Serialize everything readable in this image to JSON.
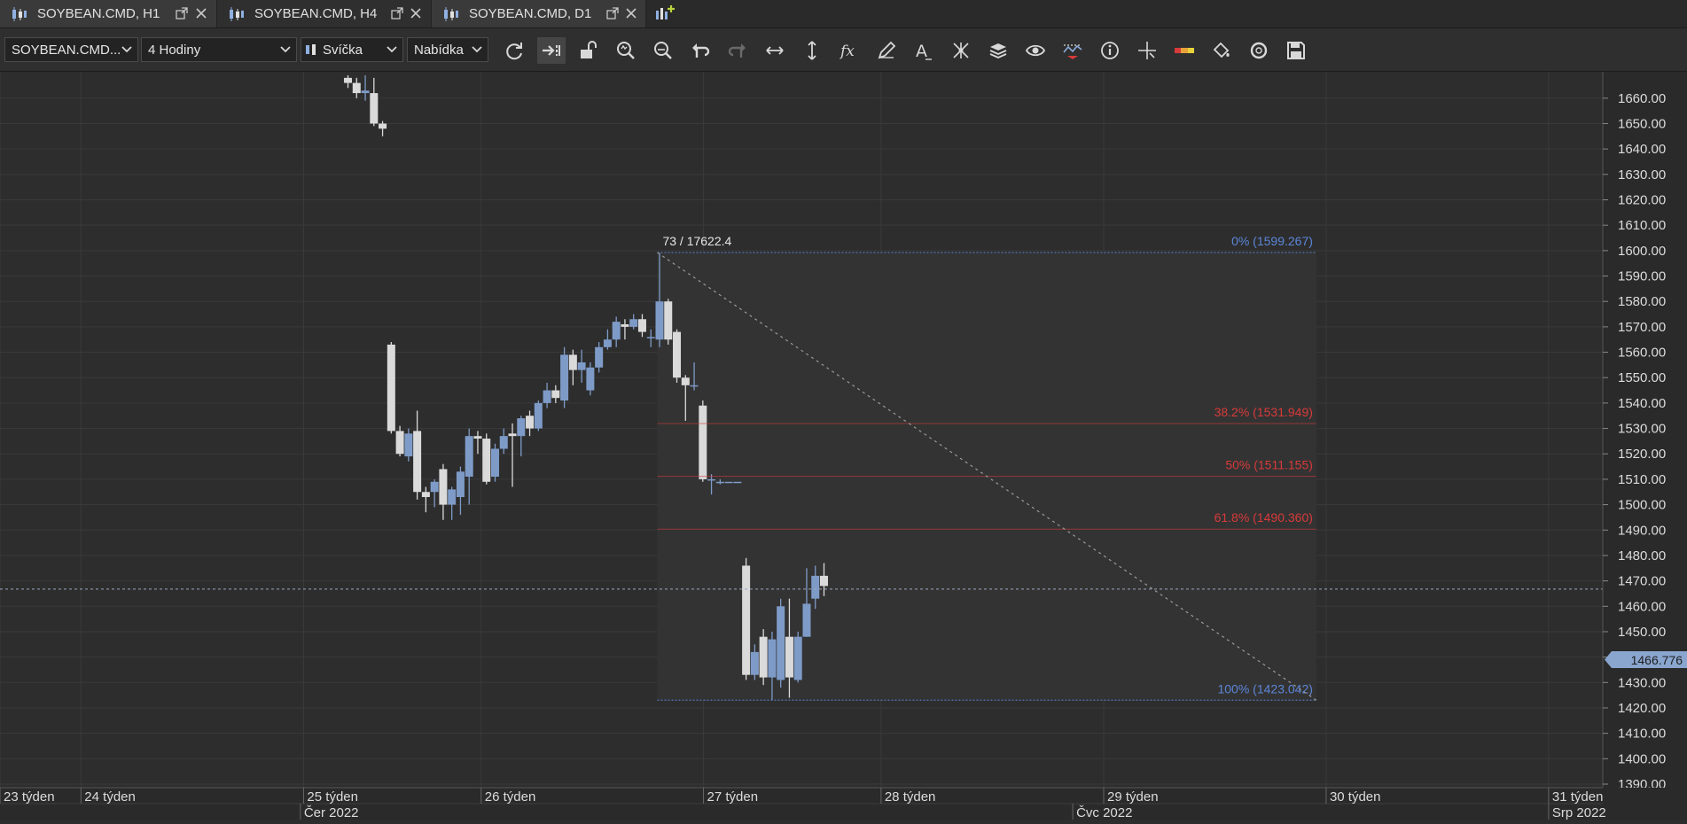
{
  "tabs": [
    {
      "label": "SOYBEAN.CMD, H1",
      "active": false
    },
    {
      "label": "SOYBEAN.CMD, H4",
      "active": true
    },
    {
      "label": "SOYBEAN.CMD, D1",
      "active": false
    }
  ],
  "toolbar": {
    "symbol": "SOYBEAN.CMD...",
    "timeframe": "4 Hodiny",
    "chart_type": "Svíčka",
    "price_type": "Nabídka",
    "tools": [
      "refresh-icon",
      "auto-scroll-icon",
      "unlock-icon",
      "zoom-in-icon",
      "zoom-out-icon",
      "undo-icon",
      "redo-icon",
      "horizontal-line-icon",
      "vertical-line-icon",
      "function-icon",
      "pencil-icon",
      "text-icon",
      "pattern-icon",
      "layers-icon",
      "eye-icon",
      "indicator-icon",
      "info-icon",
      "crosshair-icon",
      "color-bar-icon",
      "paint-bucket-icon",
      "cycle-icon",
      "save-icon"
    ]
  },
  "colors": {
    "background": "#2d2d2d",
    "bull": "#7e9bc8",
    "bear": "#dadada",
    "fib_blue": "#5c86d8",
    "fib_red": "#d83a3a",
    "axis_text": "#dcdcdc"
  },
  "chart_data": {
    "type": "candlestick",
    "ylim": [
      1390,
      1669
    ],
    "yticks": [
      1660,
      1650,
      1640,
      1630,
      1620,
      1610,
      1600,
      1590,
      1580,
      1570,
      1560,
      1550,
      1540,
      1530,
      1520,
      1510,
      1500,
      1490,
      1480,
      1470,
      1460,
      1450,
      1440,
      1430,
      1420,
      1410,
      1400,
      1390
    ],
    "ytick_labels": [
      "1660.00",
      "1650.00",
      "1640.00",
      "1630.00",
      "1620.00",
      "1610.00",
      "1600.00",
      "1590.00",
      "1580.00",
      "1570.00",
      "1560.00",
      "1550.00",
      "1540.00",
      "1530.00",
      "1520.00",
      "1510.00",
      "1500.00",
      "1490.00",
      "1480.00",
      "1470.00",
      "1460.00",
      "1450.00",
      "1440.00",
      "1430.00",
      "1420.00",
      "1410.00",
      "1400.00",
      "1390.00"
    ],
    "current_price": "1466.776",
    "current_price_value": 1466.776,
    "x_labels": [
      {
        "label": "23 týden",
        "pos": 0.0
      },
      {
        "label": "24 týden",
        "pos": 0.0505
      },
      {
        "label": "25 týden",
        "pos": 0.1894
      },
      {
        "label": "26 týden",
        "pos": 0.3002
      },
      {
        "label": "27 týden",
        "pos": 0.4389
      },
      {
        "label": "28 týden",
        "pos": 0.5497
      },
      {
        "label": "29 týden",
        "pos": 0.6886
      },
      {
        "label": "30 týden",
        "pos": 0.8274
      },
      {
        "label": "31 týden",
        "pos": 0.9662
      }
    ],
    "month_labels": [
      {
        "label": "Čer 2022",
        "pos": 0.1874
      },
      {
        "label": "Čvc 2022",
        "pos": 0.6693
      },
      {
        "label": "Srp 2022",
        "pos": 0.9662
      }
    ],
    "candles": [
      [
        0.2171,
        1668,
        1666,
        1669,
        1664
      ],
      [
        0.2225,
        1666,
        1662,
        1668,
        1660
      ],
      [
        0.2279,
        1662,
        1663,
        1669,
        1659
      ],
      [
        0.2333,
        1662,
        1650,
        1668,
        1649
      ],
      [
        0.2387,
        1650,
        1648,
        1651,
        1645
      ],
      [
        0.2441,
        1563,
        1529,
        1564,
        1528
      ],
      [
        0.2495,
        1529,
        1520,
        1531,
        1519
      ],
      [
        0.2549,
        1519,
        1528,
        1530,
        1517
      ],
      [
        0.2603,
        1529,
        1505,
        1537,
        1502
      ],
      [
        0.2657,
        1505,
        1503,
        1507,
        1497
      ],
      [
        0.2711,
        1505,
        1509,
        1510,
        1499
      ],
      [
        0.2765,
        1514,
        1500,
        1516,
        1494
      ],
      [
        0.2819,
        1500,
        1506,
        1507,
        1494
      ],
      [
        0.2873,
        1503,
        1513,
        1515,
        1496
      ],
      [
        0.2927,
        1511,
        1527,
        1530,
        1500
      ],
      [
        0.2981,
        1527,
        1526,
        1529,
        1520
      ],
      [
        0.3035,
        1526,
        1509,
        1528,
        1508
      ],
      [
        0.3089,
        1511,
        1522,
        1524,
        1509
      ],
      [
        0.3143,
        1522,
        1527,
        1530,
        1520
      ],
      [
        0.3197,
        1528,
        1527,
        1532,
        1507
      ],
      [
        0.3251,
        1527,
        1534,
        1535,
        1519
      ],
      [
        0.3305,
        1535,
        1530,
        1537,
        1527
      ],
      [
        0.3359,
        1530,
        1540,
        1541,
        1529
      ],
      [
        0.3413,
        1540,
        1545,
        1548,
        1538
      ],
      [
        0.3467,
        1545,
        1542,
        1547,
        1540
      ],
      [
        0.3521,
        1541,
        1559,
        1562,
        1538
      ],
      [
        0.3575,
        1559,
        1553,
        1561,
        1547
      ],
      [
        0.3629,
        1553,
        1556,
        1561,
        1548
      ],
      [
        0.3683,
        1545,
        1554,
        1556,
        1543
      ],
      [
        0.3737,
        1554,
        1562,
        1564,
        1552
      ],
      [
        0.3791,
        1562,
        1565,
        1569,
        1561
      ],
      [
        0.3845,
        1565,
        1572,
        1574,
        1562
      ],
      [
        0.3899,
        1571,
        1570,
        1573,
        1565
      ],
      [
        0.3953,
        1570,
        1573,
        1575,
        1569
      ],
      [
        0.4007,
        1573,
        1568,
        1575,
        1566
      ],
      [
        0.4061,
        1566,
        1566,
        1569,
        1562
      ],
      [
        0.4115,
        1565,
        1580,
        1599,
        1562
      ],
      [
        0.4169,
        1580,
        1565,
        1581,
        1563
      ],
      [
        0.4223,
        1568,
        1550,
        1569,
        1548
      ],
      [
        0.4277,
        1550,
        1547,
        1551,
        1533
      ],
      [
        0.4331,
        1547,
        1547,
        1556,
        1545
      ],
      [
        0.4385,
        1539,
        1510,
        1541,
        1509
      ],
      [
        0.4439,
        1510,
        1510,
        1512,
        1504
      ],
      [
        0.4493,
        1509,
        1509,
        1510,
        1508
      ],
      [
        0.4547,
        1509,
        1509,
        1509,
        1509
      ],
      [
        0.4601,
        1509,
        1509,
        1509,
        1509
      ],
      [
        0.4655,
        1476,
        1433,
        1479,
        1431
      ],
      [
        0.4709,
        1433,
        1442,
        1445,
        1431
      ],
      [
        0.4763,
        1448,
        1432,
        1451,
        1429
      ],
      [
        0.4817,
        1432,
        1447,
        1450,
        1423
      ],
      [
        0.4871,
        1431,
        1460,
        1463,
        1428
      ],
      [
        0.4925,
        1448,
        1432,
        1463,
        1424
      ],
      [
        0.4979,
        1431,
        1448,
        1450,
        1430
      ],
      [
        0.5033,
        1448,
        1461,
        1475,
        1448
      ],
      [
        0.5087,
        1463,
        1472,
        1476,
        1459
      ],
      [
        0.5141,
        1472,
        1468,
        1477,
        1464
      ]
    ],
    "fibonacci": {
      "x_start": 0.4101,
      "x_end": 0.8213,
      "levels": [
        {
          "label": "0% (1599.267)",
          "price": 1599.267,
          "color": "blue"
        },
        {
          "label": "38.2% (1531.949)",
          "price": 1531.949,
          "color": "red"
        },
        {
          "label": "50% (1511.155)",
          "price": 1511.155,
          "color": "red"
        },
        {
          "label": "61.8% (1490.360)",
          "price": 1490.36,
          "color": "red"
        },
        {
          "label": "100% (1423.042)",
          "price": 1423.042,
          "color": "blue"
        }
      ],
      "anchor_label": "73 / 17622.4"
    }
  }
}
